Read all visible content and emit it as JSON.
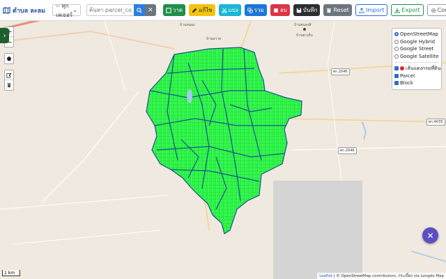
{
  "app": {
    "title": "ตำบล ละลม"
  },
  "toolbar": {
    "layer_select": "-- ทุกเลเยอร์",
    "search_placeholder": "ค้นหา parcel_code",
    "draw_label": "วาด",
    "edit_label": "แก้ไข",
    "split_label": "แบ่ง",
    "merge_label": "รวม",
    "delete_label": "ลบ",
    "save_label": "บันทึก",
    "reset_label": "Reset",
    "import_label": "Import",
    "export_label": "Export",
    "config_label": "Config"
  },
  "colors": {
    "parcel_fill": "#33ff4c",
    "block_stroke": "#1d4f8f",
    "accent": "#2f6bd0"
  },
  "layers": {
    "base": [
      {
        "label": "OpenStreetMap",
        "selected": true
      },
      {
        "label": "Google Hybrid",
        "selected": false
      },
      {
        "label": "Google Street",
        "selected": false
      },
      {
        "label": "Google Satellite",
        "selected": false
      }
    ],
    "overlays": [
      {
        "label": "เส้นแดงกรมที่ดิน",
        "checked": true
      },
      {
        "label": "Parcel",
        "checked": true
      },
      {
        "label": "Block",
        "checked": true
      }
    ]
  },
  "map": {
    "scale_label": "1 km",
    "attribution_leaflet": "Leaflet",
    "attribution_text": "| © OpenStreetMap contributors, กระเบื้อง via Longdo Map",
    "place_labels": [
      "บ้านหนอง",
      "บ้านสวาย",
      "บ้านหนองสิ",
      "บ้านตาเห็บ"
    ],
    "road_shields": [
      "ศก.2046",
      "ศก.4035",
      "ศก.2046"
    ]
  }
}
